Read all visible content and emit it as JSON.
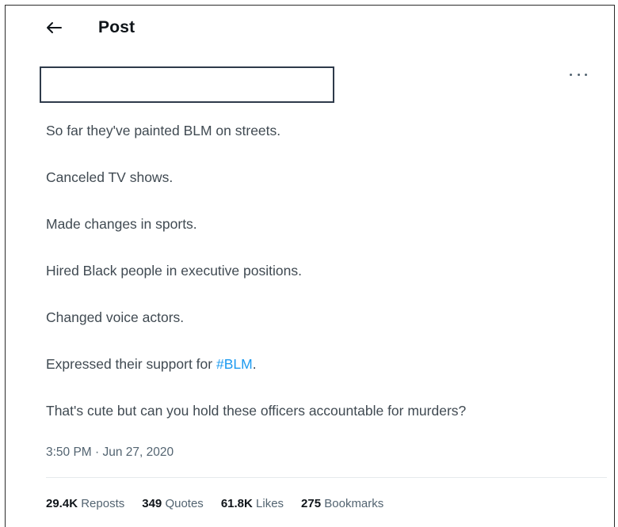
{
  "header": {
    "back_icon": "arrow-left-icon",
    "title": "Post"
  },
  "post": {
    "more_icon": "more-horizontal-icon",
    "lines": [
      "So far they've painted BLM on streets.",
      "Canceled TV shows.",
      "Made changes in sports.",
      "Hired Black people in executive positions.",
      "Changed voice actors."
    ],
    "support_prefix": "Expressed their support for ",
    "hashtag": "#BLM",
    "support_suffix": ".",
    "closing": "That's cute but can you hold these officers accountable for murders?",
    "timestamp": "3:50 PM · Jun 27, 2020"
  },
  "stats": {
    "reposts_count": "29.4K",
    "reposts_label": "Reposts",
    "quotes_count": "349",
    "quotes_label": "Quotes",
    "likes_count": "61.8K",
    "likes_label": "Likes",
    "bookmarks_count": "275",
    "bookmarks_label": "Bookmarks"
  },
  "colors": {
    "hashtag": "#1d9bf0",
    "secondary_text": "#536471",
    "primary_text": "#0f1419"
  }
}
